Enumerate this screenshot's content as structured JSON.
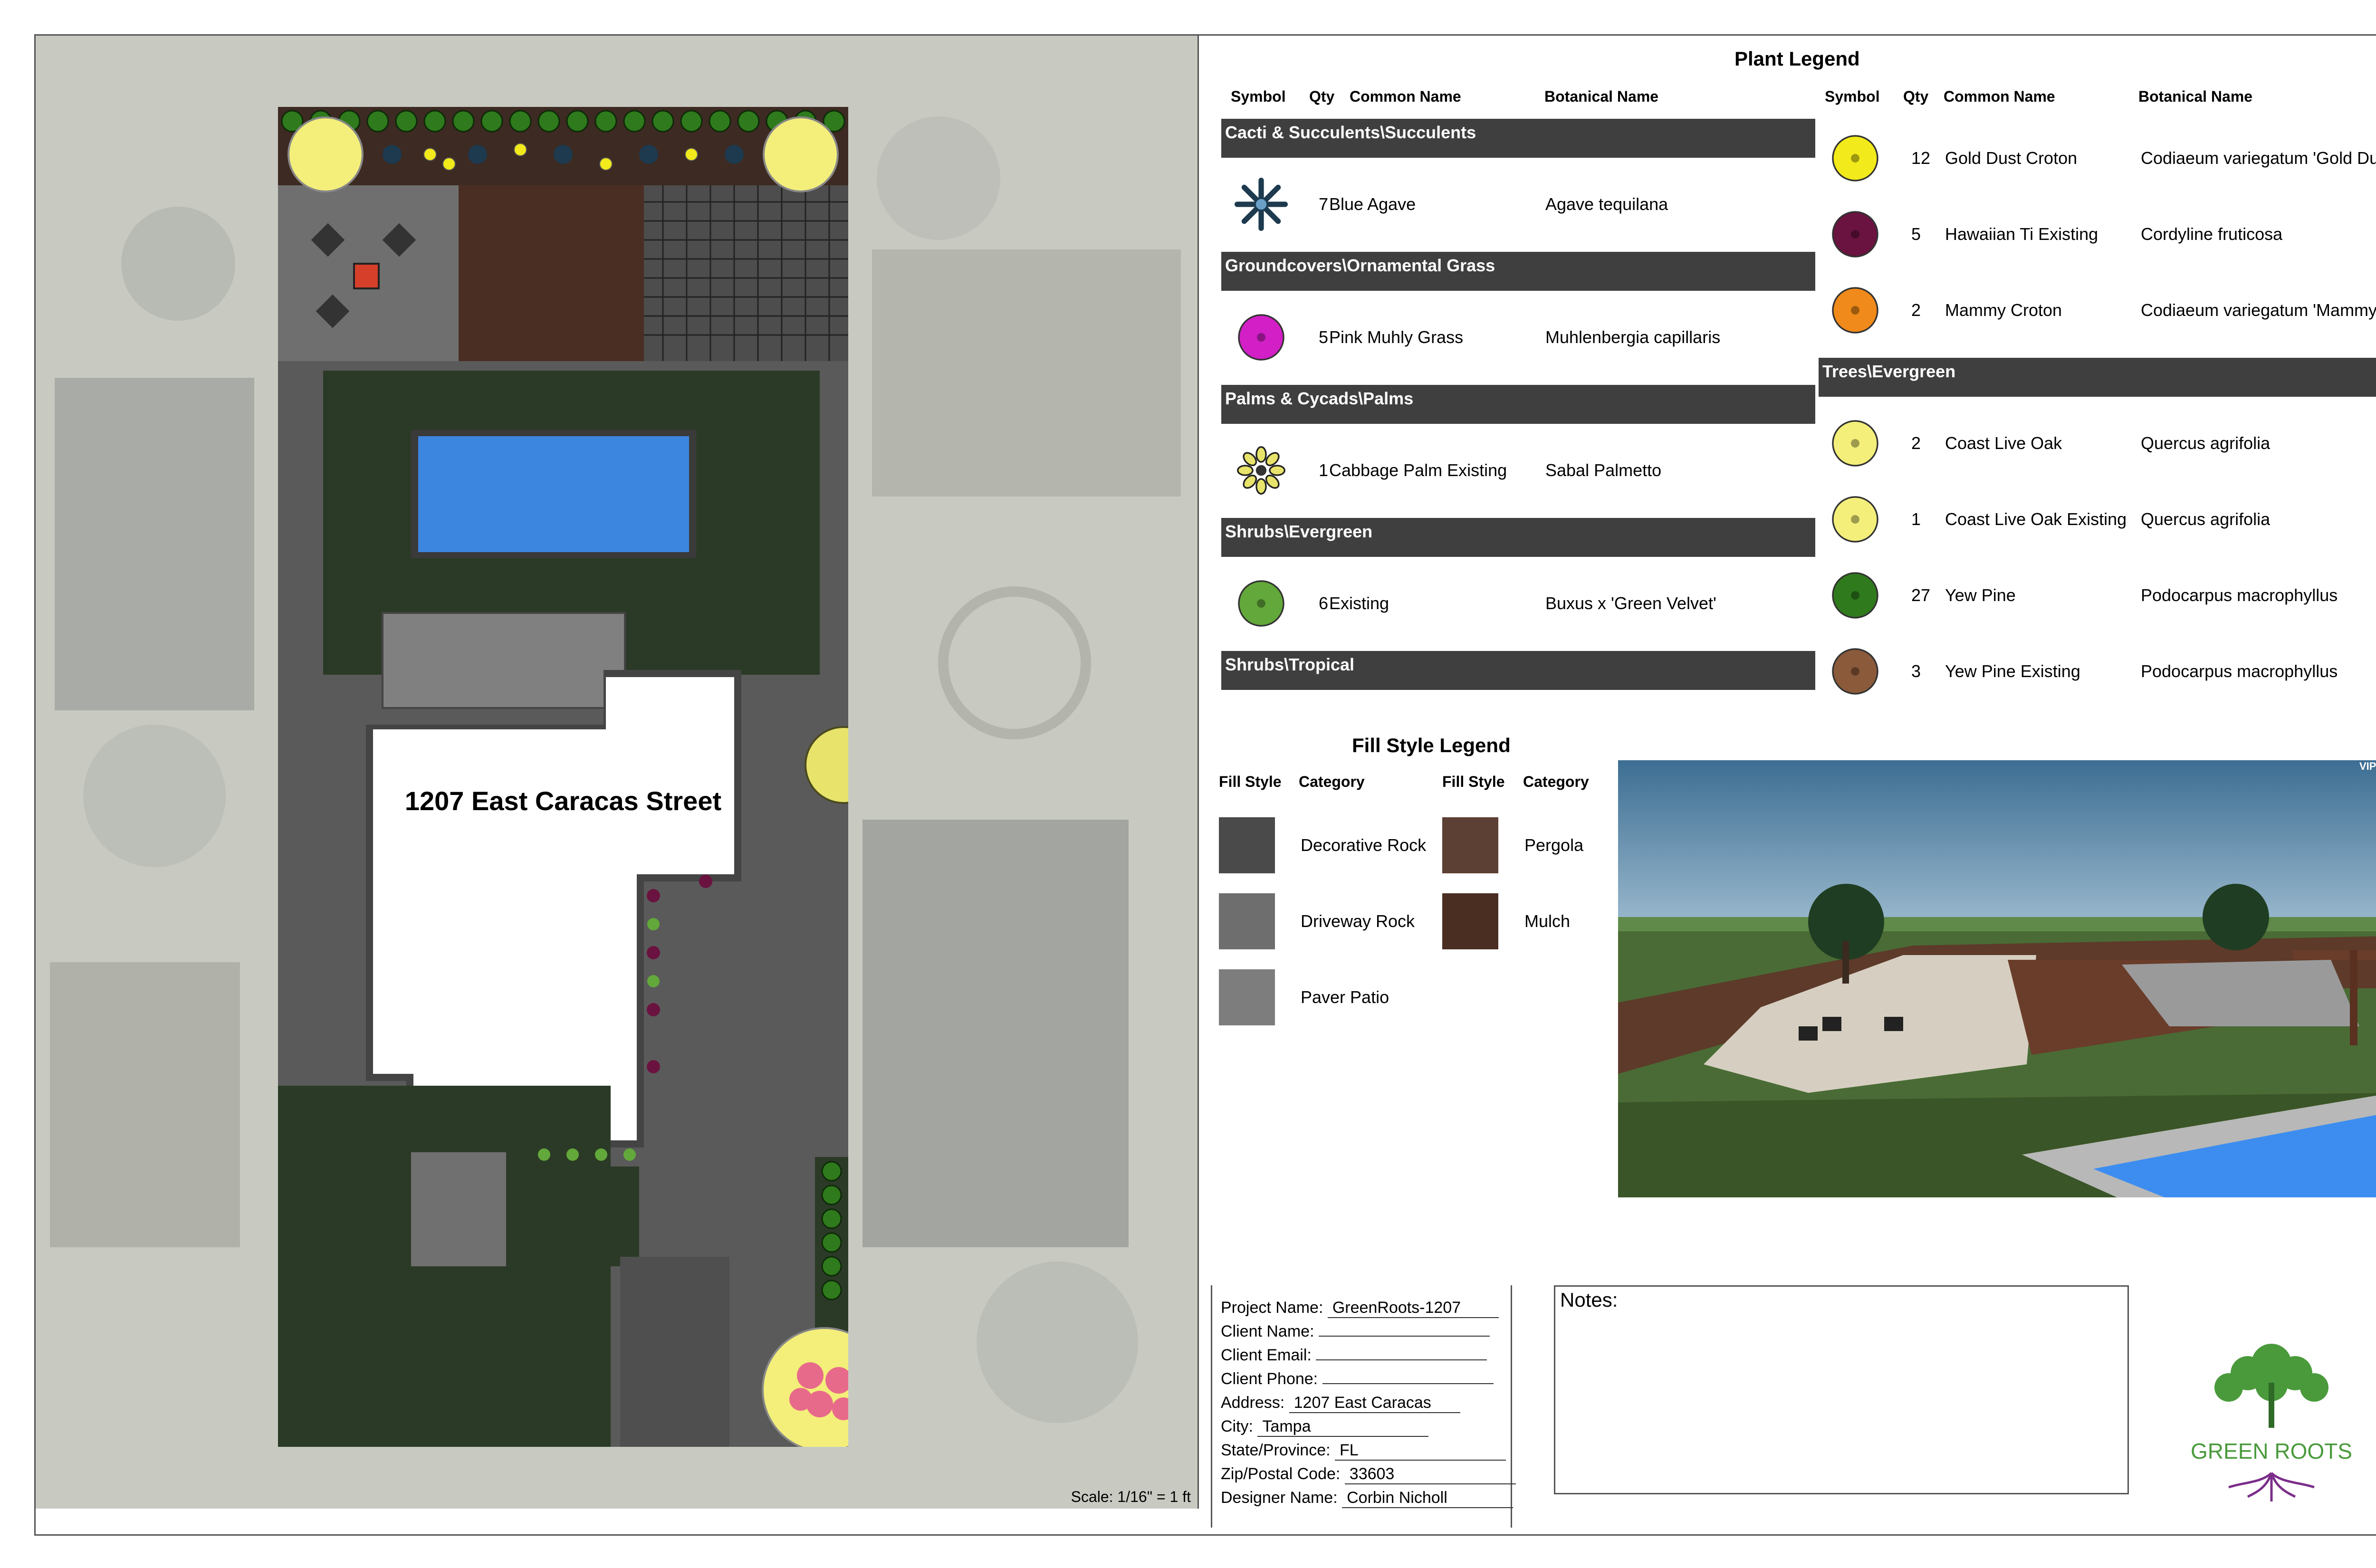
{
  "plan": {
    "address_label": "1207 East Caracas Street",
    "scale_text": "Scale: 1/16\" = 1 ft"
  },
  "plant_legend": {
    "title": "Plant Legend",
    "headers": {
      "symbol": "Symbol",
      "qty": "Qty",
      "common": "Common Name",
      "botanical": "Botanical Name"
    },
    "left": [
      {
        "type": "category",
        "label": "Cacti & Succulents\\Succulents"
      },
      {
        "type": "plant",
        "qty": "7",
        "common": "Blue Agave",
        "botanical": "Agave tequilana",
        "icon": "blue-agave-icon",
        "color": "#1d3a4f"
      },
      {
        "type": "category",
        "label": "Groundcovers\\Ornamental Grass"
      },
      {
        "type": "plant",
        "qty": "5",
        "common": "Pink Muhly Grass",
        "botanical": "Muhlenbergia capillaris",
        "icon": "pink-muhly-icon",
        "color": "#d21fc6"
      },
      {
        "type": "category",
        "label": "Palms & Cycads\\Palms"
      },
      {
        "type": "plant",
        "qty": "1",
        "common": "Cabbage Palm Existing",
        "botanical": "Sabal Palmetto",
        "icon": "cabbage-palm-icon",
        "color": "#e8e36a"
      },
      {
        "type": "category",
        "label": "Shrubs\\Evergreen"
      },
      {
        "type": "plant",
        "qty": "6",
        "common": "Existing",
        "botanical": "Buxus x 'Green Velvet'",
        "icon": "boxwood-icon",
        "color": "#62a83a"
      },
      {
        "type": "category",
        "label": "Shrubs\\Tropical"
      }
    ],
    "right": [
      {
        "type": "plant",
        "qty": "12",
        "common": "Gold Dust Croton",
        "botanical": "Codiaeum variegatum 'Gold Du",
        "icon": "gold-dust-croton-icon",
        "color": "#f2ea1a"
      },
      {
        "type": "plant",
        "qty": "5",
        "common": "Hawaiian Ti Existing",
        "botanical": "Cordyline fruticosa",
        "icon": "hawaiian-ti-icon",
        "color": "#6a1240"
      },
      {
        "type": "plant",
        "qty": "2",
        "common": "Mammy Croton",
        "botanical": "Codiaeum variegatum 'Mammy",
        "icon": "mammy-croton-icon",
        "color": "#f08a1a"
      },
      {
        "type": "category",
        "label": "Trees\\Evergreen"
      },
      {
        "type": "plant",
        "qty": "2",
        "common": "Coast Live Oak",
        "botanical": "Quercus agrifolia",
        "icon": "coast-live-oak-icon",
        "color": "#f3ef7a"
      },
      {
        "type": "plant",
        "qty": "1",
        "common": "Coast Live Oak Existing",
        "botanical": "Quercus agrifolia",
        "icon": "coast-live-oak-existing-icon",
        "color": "#f3ef7a"
      },
      {
        "type": "plant",
        "qty": "27",
        "common": "Yew Pine",
        "botanical": "Podocarpus macrophyllus",
        "icon": "yew-pine-icon",
        "color": "#2f7a1c"
      },
      {
        "type": "plant",
        "qty": "3",
        "common": "Yew Pine Existing",
        "botanical": "Podocarpus macrophyllus",
        "icon": "yew-pine-existing-icon",
        "color": "#8a5a3a"
      }
    ]
  },
  "fill_legend": {
    "title": "Fill Style Legend",
    "headers": {
      "fill": "Fill Style",
      "category": "Category"
    },
    "left": [
      {
        "label": "Decorative Rock",
        "color": "#4a4a4a"
      },
      {
        "label": "Driveway Rock",
        "color": "#6e6e6e"
      },
      {
        "label": "Paver Patio",
        "color": "#7d7d7d"
      }
    ],
    "right": [
      {
        "label": "Pergola",
        "color": "#5c4033"
      },
      {
        "label": "Mulch",
        "color": "#4a2e22"
      }
    ]
  },
  "render": {
    "watermark": "VIPSO"
  },
  "title_block": {
    "rows": [
      {
        "label": "Project Name:",
        "value": "GreenRoots-1207"
      },
      {
        "label": "Client Name:",
        "value": ""
      },
      {
        "label": "Client Email:",
        "value": ""
      },
      {
        "label": "Client Phone:",
        "value": ""
      },
      {
        "label": "Address:",
        "value": "1207 East Caracas"
      },
      {
        "label": "City:",
        "value": "Tampa"
      },
      {
        "label": "State/Province:",
        "value": "FL"
      },
      {
        "label": "Zip/Postal Code:",
        "value": "33603"
      },
      {
        "label": "Designer Name:",
        "value": "Corbin Nicholl"
      }
    ]
  },
  "notes": {
    "label": "Notes:"
  },
  "logo": {
    "text": "GREEN ROOTS",
    "brand_color": "#4a9a3c"
  }
}
